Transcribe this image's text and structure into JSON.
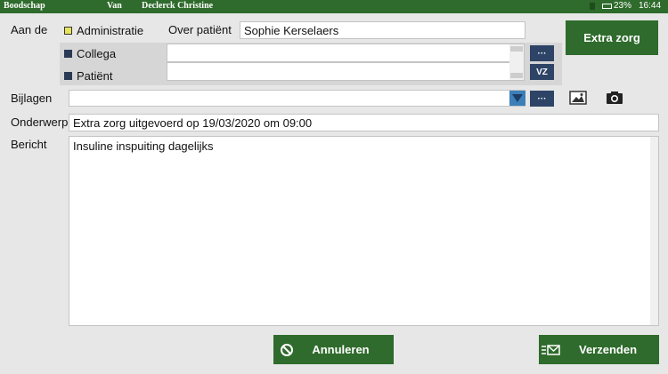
{
  "topbar": {
    "title": "Boodschap",
    "van_label": "Van",
    "sender": "Declerck Christine",
    "battery": "23%",
    "time": "16:44"
  },
  "form": {
    "aan_de_label": "Aan de",
    "recipients": [
      {
        "label": "Administratie",
        "checked": true
      },
      {
        "label": "Collega",
        "checked": false
      },
      {
        "label": "Patiënt",
        "checked": false
      }
    ],
    "over_patient_label": "Over patiënt",
    "patient_value": "Sophie Kerselaers",
    "recipient_field_1": "",
    "recipient_field_2": "",
    "more_button": "···",
    "vz_button": "VZ",
    "extra_zorg_button": "Extra zorg",
    "bijlagen_label": "Bijlagen",
    "bijlagen_value": "",
    "onderwerp_label": "Onderwerp",
    "onderwerp_value": "Extra zorg uitgevoerd op 19/03/2020 om 09:00",
    "bericht_label": "Bericht",
    "bericht_value": "Insuline inspuiting dagelijks"
  },
  "actions": {
    "cancel": "Annuleren",
    "send": "Verzenden"
  },
  "colors": {
    "brand_green": "#2f6b2c",
    "dark_blue": "#2e4466",
    "dropdown_blue": "#3d7fb8"
  }
}
